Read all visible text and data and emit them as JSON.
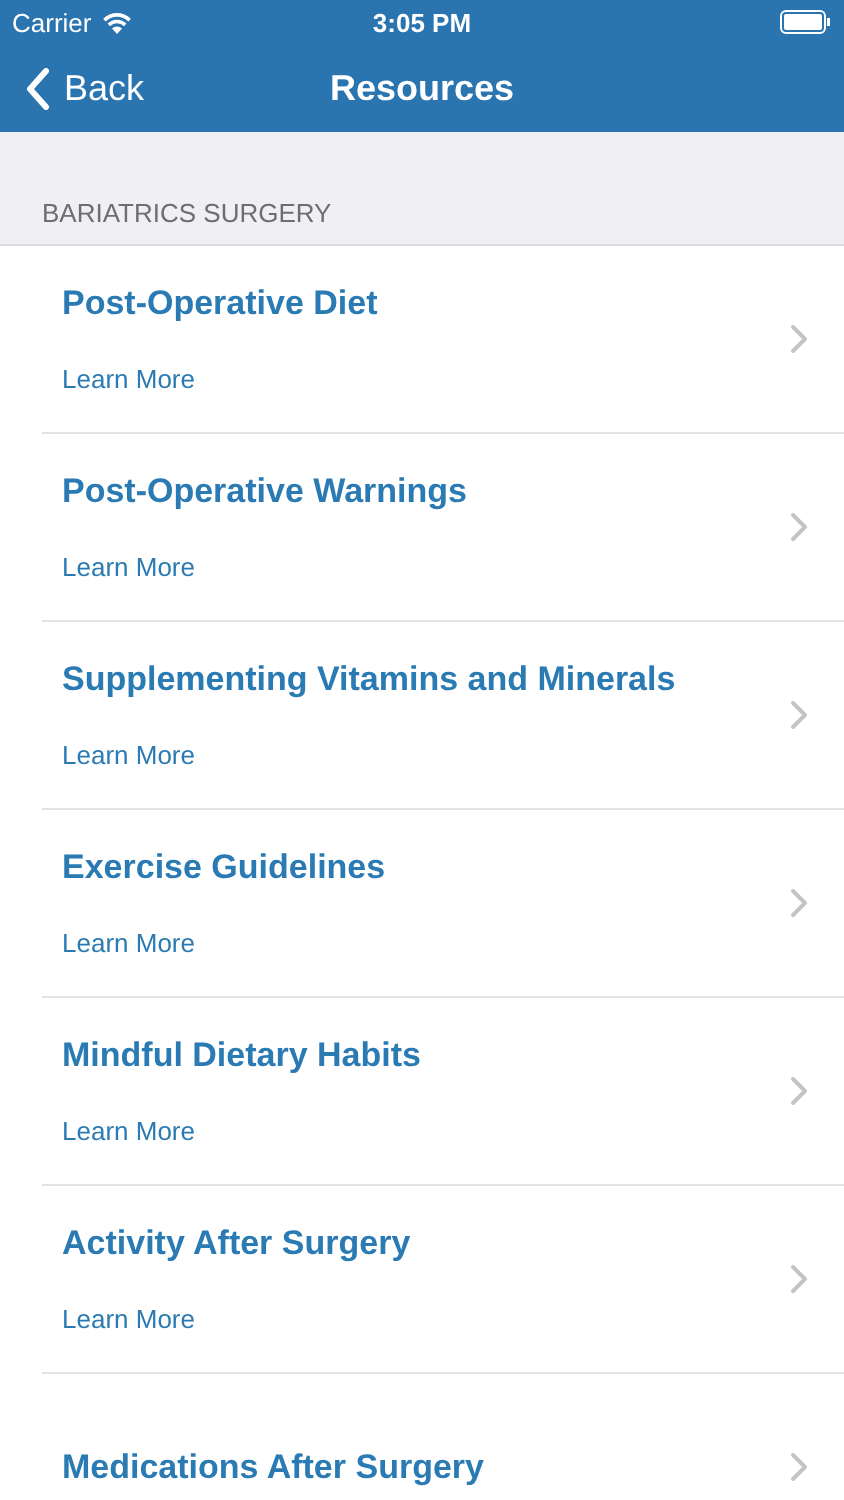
{
  "status_bar": {
    "carrier": "Carrier",
    "time": "3:05 PM"
  },
  "nav_bar": {
    "back": "Back",
    "title": "Resources"
  },
  "section": {
    "header": "BARIATRICS SURGERY",
    "items": [
      {
        "title": "Post-Operative Diet",
        "link": "Learn More"
      },
      {
        "title": "Post-Operative Warnings",
        "link": "Learn More"
      },
      {
        "title": "Supplementing Vitamins and Minerals",
        "link": "Learn More"
      },
      {
        "title": "Exercise Guidelines",
        "link": "Learn More"
      },
      {
        "title": "Mindful Dietary Habits",
        "link": "Learn More"
      },
      {
        "title": "Activity After Surgery",
        "link": "Learn More"
      },
      {
        "title": "Medications After Surgery"
      }
    ]
  }
}
